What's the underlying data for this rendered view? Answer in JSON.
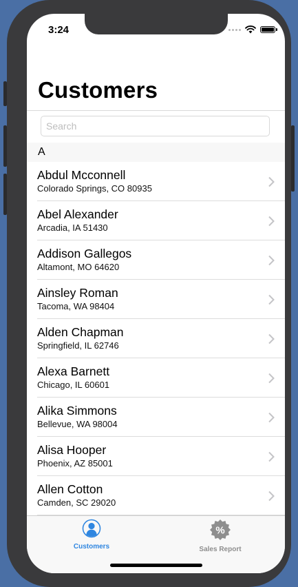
{
  "status_bar": {
    "time": "3:24"
  },
  "nav": {
    "title": "Customers"
  },
  "search": {
    "placeholder": "Search",
    "value": ""
  },
  "section": {
    "header": "A"
  },
  "customers": [
    {
      "name": "Abdul Mcconnell",
      "address": "Colorado Springs, CO 80935"
    },
    {
      "name": "Abel Alexander",
      "address": "Arcadia, IA 51430"
    },
    {
      "name": "Addison Gallegos",
      "address": "Altamont, MO 64620"
    },
    {
      "name": "Ainsley Roman",
      "address": "Tacoma, WA 98404"
    },
    {
      "name": "Alden Chapman",
      "address": "Springfield, IL 62746"
    },
    {
      "name": "Alexa Barnett",
      "address": "Chicago, IL 60601"
    },
    {
      "name": "Alika Simmons",
      "address": "Bellevue, WA 98004"
    },
    {
      "name": "Alisa Hooper",
      "address": "Phoenix, AZ 85001"
    },
    {
      "name": "Allen Cotton",
      "address": "Camden, SC 29020"
    }
  ],
  "tabbar": {
    "tabs": [
      {
        "label": "Customers",
        "icon": "person-icon",
        "selected": true
      },
      {
        "label": "Sales Report",
        "icon": "percent-badge-icon",
        "selected": false
      }
    ]
  },
  "colors": {
    "accent": "#2f86e0",
    "inactive_tab": "#8e8e8e",
    "background": "#4a6fa5"
  }
}
